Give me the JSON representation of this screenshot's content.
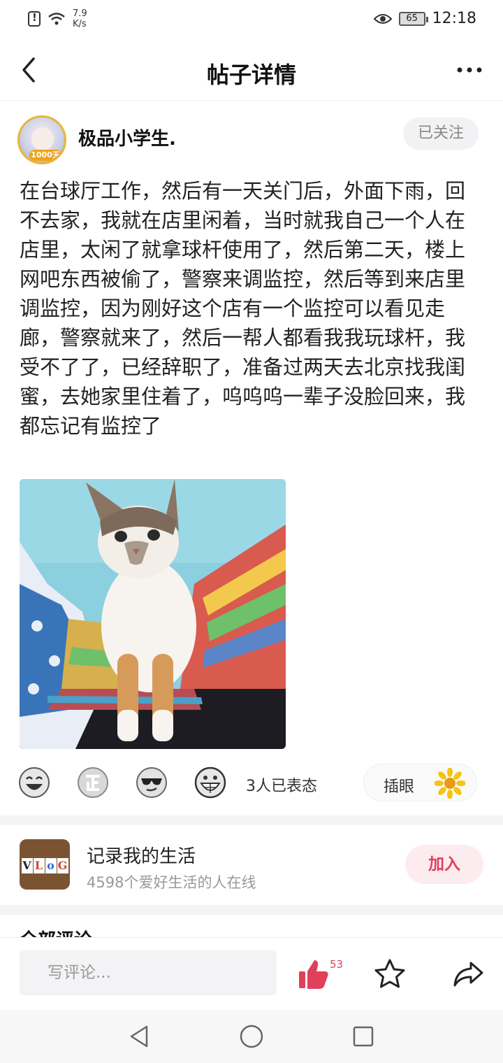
{
  "status_bar": {
    "speed_value": "7.9",
    "speed_unit": "K/s",
    "battery": "65",
    "time": "12:18"
  },
  "header": {
    "title": "帖子详情"
  },
  "author": {
    "name": "极品小学生.",
    "badge": "1000天",
    "follow_label": "已关注"
  },
  "post": {
    "text": "在台球厅工作，然后有一天关门后，外面下雨，回不去家，我就在店里闲着，当时就我自己一个人在店里，太闲了就拿球杆使用了，然后第二天，楼上网吧东西被偷了，警察来调监控，然后等到来店里调监控，因为刚好这个店有一个监控可以看见走廊，警察就来了，然后一帮人都看我我玩球杆，我受不了了，已经辞职了，准备过两天去北京找我闺蜜，去她家里住着了，呜呜呜一辈子没脸回来，我都忘记有监控了"
  },
  "reactions": {
    "count_text": "3人已表态",
    "tag_label": "插眼"
  },
  "group": {
    "logo_letters": [
      "V",
      "L",
      "o",
      "G"
    ],
    "title": "记录我的生活",
    "subtitle": "4598个爱好生活的人在线",
    "join_label": "加入"
  },
  "comments": {
    "heading": "全部评论"
  },
  "action_bar": {
    "comment_placeholder": "写评论...",
    "like_count": "53"
  },
  "colors": {
    "accent": "#e0405a",
    "follow_bg": "#f2f2f4",
    "divider": "#f4f4f6"
  },
  "icons": {
    "back": "back-chevron-icon",
    "more": "more-dots-icon",
    "like": "thumbs-up-icon",
    "star": "star-icon",
    "share": "share-arrow-icon"
  }
}
